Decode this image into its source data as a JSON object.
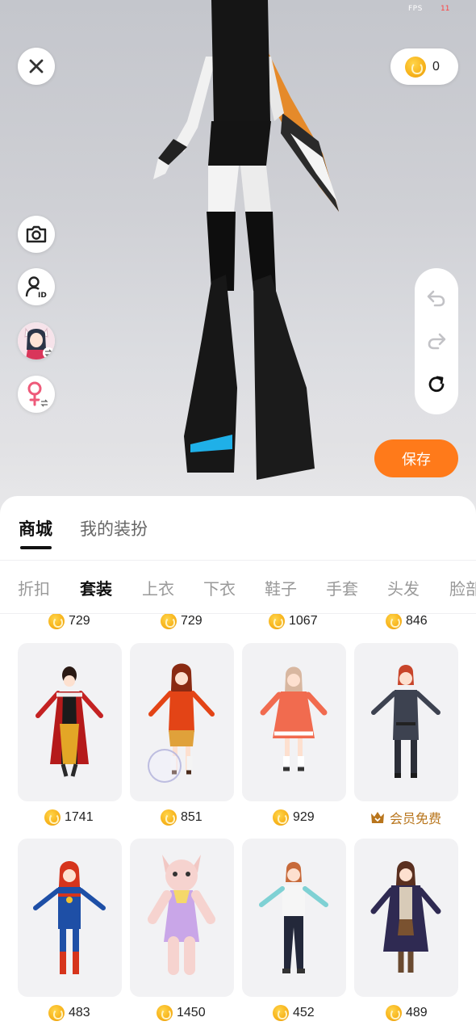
{
  "status": {
    "fps_label": "FPS",
    "fps_value": "11"
  },
  "toolbar": {
    "coin_balance": "0",
    "save_label": "保存"
  },
  "sheet": {
    "top_tabs": [
      "商城",
      "我的装扮"
    ],
    "categories": [
      "折扣",
      "套装",
      "上衣",
      "下衣",
      "鞋子",
      "手套",
      "头发",
      "脸部"
    ],
    "active_category": "套装",
    "previous_row_prices": [
      "729",
      "729",
      "1067",
      "846"
    ],
    "items": [
      {
        "price": "1741",
        "outfit": "red-gold chinese dress",
        "vip": false
      },
      {
        "price": "851",
        "outfit": "red school uniform",
        "vip": false
      },
      {
        "price": "929",
        "outfit": "red white winter dress",
        "vip": false
      },
      {
        "price": "会员免费",
        "outfit": "black tactical suit",
        "vip": true
      },
      {
        "price": "483",
        "outfit": "red blue hero suit",
        "vip": false
      },
      {
        "price": "1450",
        "outfit": "pink cat costume",
        "vip": false
      },
      {
        "price": "452",
        "outfit": "white tee track pants",
        "vip": false
      },
      {
        "price": "489",
        "outfit": "purple coat skirt",
        "vip": false
      }
    ]
  },
  "colors": {
    "accent": "#ff7a1a",
    "vip": "#b8751c",
    "coin": "#f7b21a"
  }
}
